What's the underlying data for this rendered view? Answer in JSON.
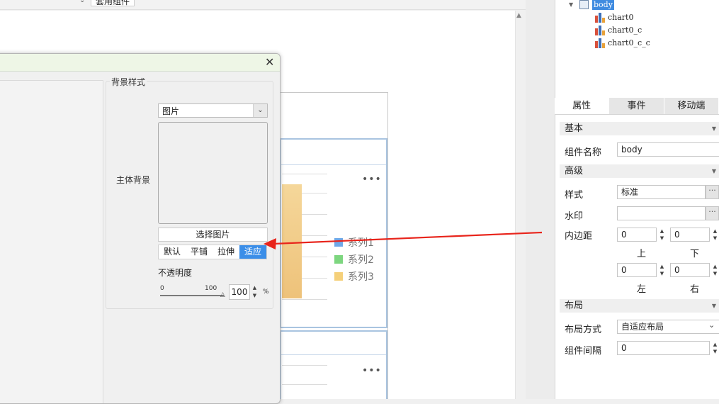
{
  "top": {
    "chevron": "⌄",
    "tab_label": "套用组件"
  },
  "chart_preview": {
    "more": "•••",
    "legend": [
      {
        "name": "系列1",
        "color": "#6fa8e8"
      },
      {
        "name": "系列2",
        "color": "#7dd67f"
      },
      {
        "name": "系列3",
        "color": "#f5d07a"
      }
    ]
  },
  "dialog": {
    "close": "✕",
    "group_title": "背景样式",
    "main_bg_label": "主体背景",
    "bg_type": "图片",
    "choose_image": "选择图片",
    "modes": [
      "默认",
      "平铺",
      "拉伸",
      "适应"
    ],
    "active_mode": "适应",
    "opacity_label": "不透明度",
    "slider_min": "0",
    "slider_max": "100",
    "opacity_value": "100",
    "percent": "%"
  },
  "tree": {
    "root": "body",
    "children": [
      "chart0",
      "chart0_c",
      "chart0_c_c"
    ]
  },
  "tabs": [
    "属性",
    "事件",
    "移动端"
  ],
  "active_tab": "属性",
  "props": {
    "basic_header": "基本",
    "component_name_label": "组件名称",
    "component_name_value": "body",
    "advanced_header": "高级",
    "style_label": "样式",
    "style_value": "标准",
    "watermark_label": "水印",
    "watermark_value": "",
    "padding_label": "内边距",
    "padding_top": "0",
    "padding_bottom": "0",
    "padding_left": "0",
    "padding_right": "0",
    "top_label": "上",
    "bottom_label": "下",
    "left_label": "左",
    "right_label": "右",
    "layout_header": "布局",
    "layout_mode_label": "布局方式",
    "layout_mode_value": "自适应布局",
    "spacing_label": "组件间隔",
    "spacing_value": "0",
    "more": "···"
  },
  "colors": {
    "accent": "#3b8ee8",
    "arrow": "#e8241b"
  }
}
